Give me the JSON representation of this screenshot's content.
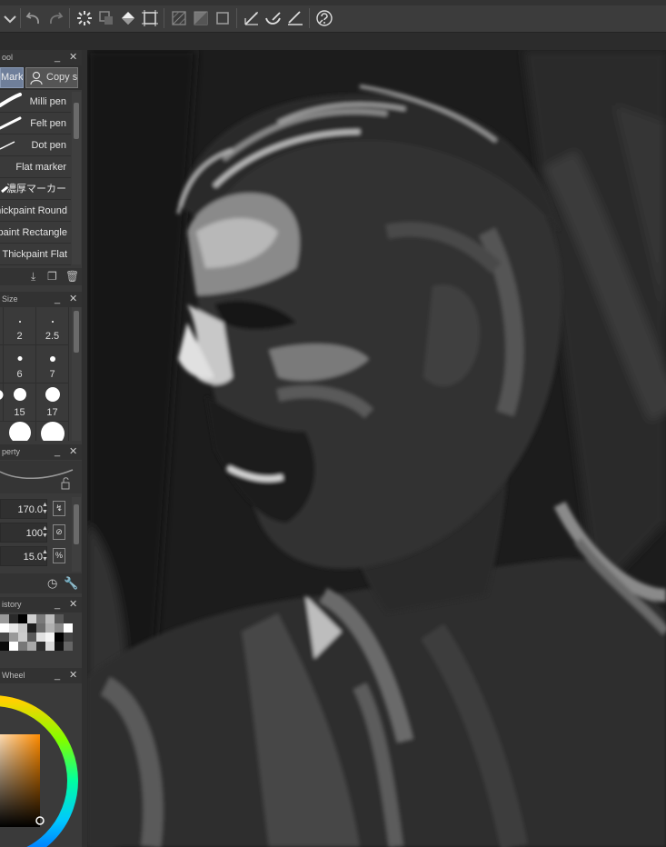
{
  "toolbar": {
    "icons": [
      "dropdown-icon",
      "undo-icon",
      "redo-icon",
      "busy-spinner-icon",
      "transform-icon",
      "fill-icon",
      "crop-icon",
      "clear-icon",
      "fill-gray-icon",
      "select-invert-icon",
      "ruler-pen-icon",
      "ruler-curve-icon",
      "ruler-line-icon",
      "help-icon"
    ]
  },
  "sub_tool": {
    "title": "ool",
    "active_tab": "Marker",
    "copy_tab": "Copy s",
    "brushes": [
      {
        "label": "Milli pen"
      },
      {
        "label": "Felt pen"
      },
      {
        "label": "Dot pen"
      },
      {
        "label": "Flat marker"
      },
      {
        "label": "濃厚マーカー"
      },
      {
        "label": "Thickpaint Round"
      },
      {
        "label": "Thickpaint Rectangle"
      },
      {
        "label": "Thickpaint Flat"
      }
    ]
  },
  "brush_size": {
    "title": "Size",
    "sizes": [
      "",
      "2",
      "2.5",
      "",
      "6",
      "7",
      "",
      "15",
      "17"
    ]
  },
  "tool_property": {
    "title": "perty",
    "values": {
      "size": "170.0",
      "opacity": "100",
      "third": "15.0"
    },
    "pct_label": "%"
  },
  "color_history": {
    "title": "istory",
    "swatches": [
      "#9a9a9a",
      "#2a2a2a",
      "#000000",
      "#d0d0d0",
      "#7a7a7a",
      "#bdbdbd",
      "#595959",
      "#3a3a3a",
      "#ffffff",
      "#e8e8e8",
      "#c8c8c8",
      "#1e1e1e",
      "#6e6e6e",
      "#b0b0b0",
      "#8a8a8a",
      "#ffffff",
      "#4a4a4a",
      "#999999",
      "#cccccc",
      "#5a5a5a",
      "#e0e0e0",
      "#f4f4f4",
      "#000000",
      "#444444",
      "#0a0a0a",
      "#ffffff",
      "#777777",
      "#a8a8a8",
      "#2e2e2e",
      "#d8d8d8",
      "#121212",
      "#666666"
    ]
  },
  "color_wheel": {
    "title": "Wheel",
    "current_color": "#b4691f"
  }
}
